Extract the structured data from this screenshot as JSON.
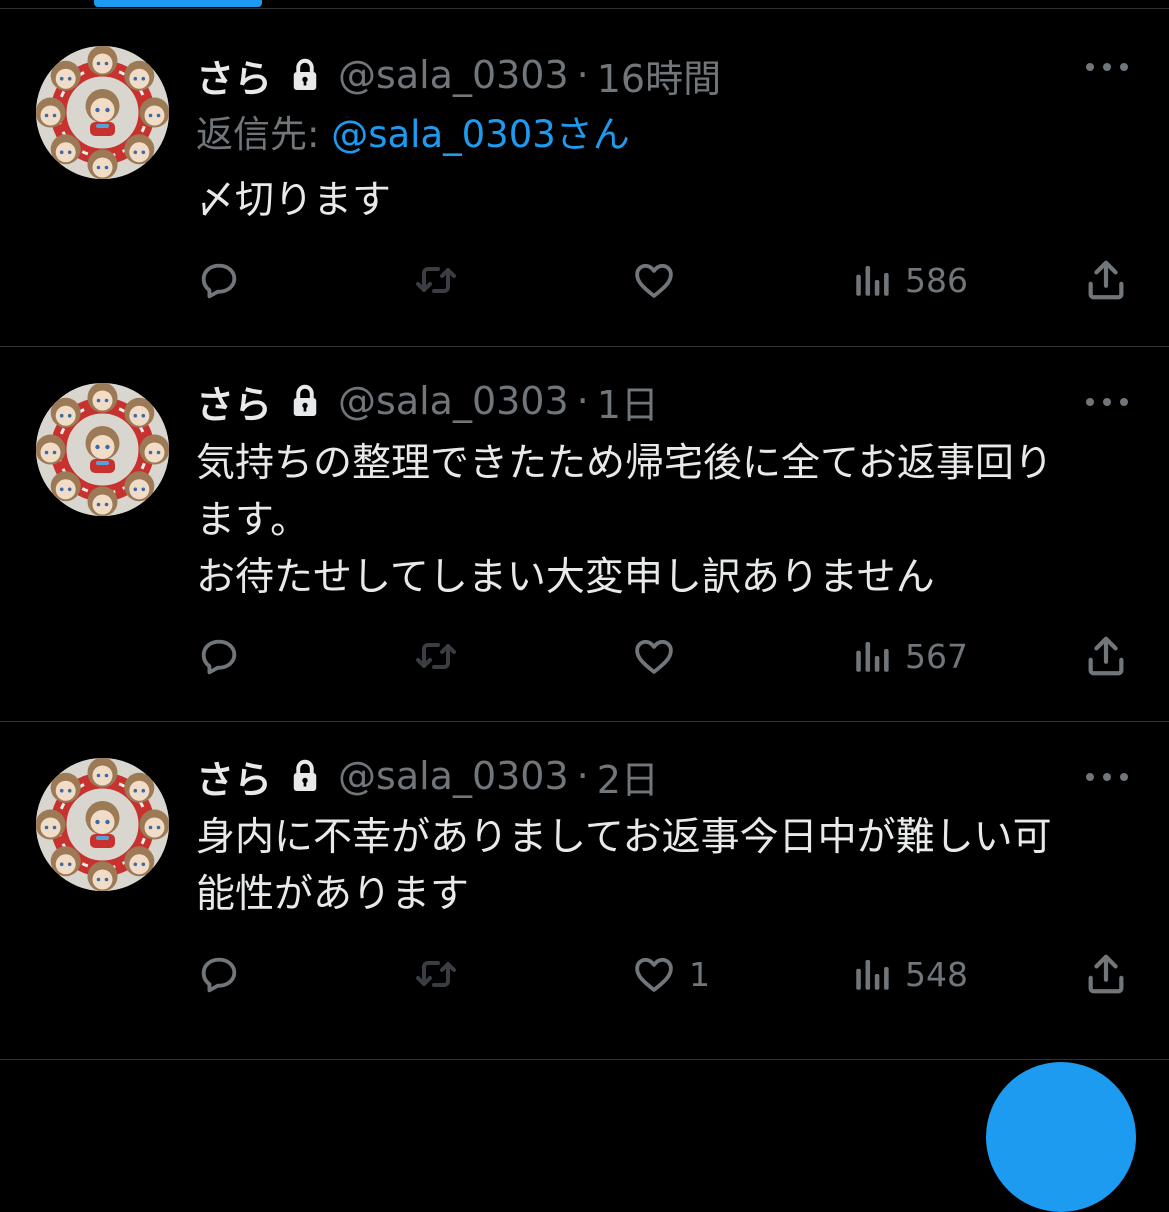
{
  "tweets": [
    {
      "name": "さら",
      "handle": "@sala_0303",
      "dot": "·",
      "time": "16時間",
      "reply_label": "返信先: ",
      "reply_mention": "@sala_0303さん",
      "lines": [
        "〆切ります"
      ],
      "likes": "",
      "views": "586"
    },
    {
      "name": "さら",
      "handle": "@sala_0303",
      "dot": "·",
      "time": "1日",
      "lines": [
        "気持ちの整理できたため帰宅後に全てお返事回り",
        "ます。",
        "お待たせしてしまい大変申し訳ありません"
      ],
      "likes": "",
      "views": "567"
    },
    {
      "name": "さら",
      "handle": "@sala_0303",
      "dot": "·",
      "time": "2日",
      "lines": [
        "身内に不幸がありましてお返事今日中が難しい可",
        "能性があります"
      ],
      "likes": "1",
      "views": "548"
    }
  ],
  "icons": {
    "reply": "reply-icon",
    "retweet": "retweet-icon",
    "like": "like-icon",
    "views": "views-icon",
    "share": "share-icon",
    "lock": "lock-icon",
    "more": "more-icon"
  },
  "colors": {
    "background": "#000000",
    "text": "#e7e9ea",
    "muted": "#71767b",
    "accent": "#1d9bf0",
    "divider": "#2f3336"
  }
}
